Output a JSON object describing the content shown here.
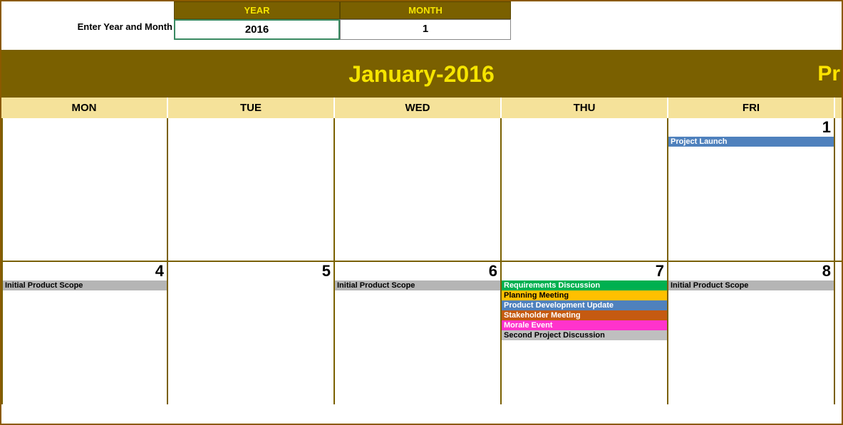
{
  "inputs": {
    "label": "Enter Year and Month",
    "year_header": "YEAR",
    "month_header": "MONTH",
    "year_value": "2016",
    "month_value": "1"
  },
  "title": "January-2016",
  "title_right": "Pr",
  "days": {
    "mon": "MON",
    "tue": "TUE",
    "wed": "WED",
    "thu": "THU",
    "fri": "FRI"
  },
  "week1": {
    "mon": {
      "num": "",
      "events": []
    },
    "tue": {
      "num": "",
      "events": []
    },
    "wed": {
      "num": "",
      "events": []
    },
    "thu": {
      "num": "",
      "events": []
    },
    "fri": {
      "num": "1",
      "events": [
        {
          "label": "Project Launch",
          "cls": "ev-blue"
        }
      ]
    }
  },
  "week2": {
    "mon": {
      "num": "4",
      "events": [
        {
          "label": "Initial Product Scope",
          "cls": "ev-gray"
        }
      ]
    },
    "tue": {
      "num": "5",
      "events": []
    },
    "wed": {
      "num": "6",
      "events": [
        {
          "label": "Initial Product Scope",
          "cls": "ev-gray"
        }
      ]
    },
    "thu": {
      "num": "7",
      "events": [
        {
          "label": "Requirements Discussion",
          "cls": "ev-green"
        },
        {
          "label": "Planning Meeting",
          "cls": "ev-yellow"
        },
        {
          "label": "Product Development Update",
          "cls": "ev-blue"
        },
        {
          "label": "Stakeholder Meeting",
          "cls": "ev-brown"
        },
        {
          "label": "Morale Event",
          "cls": "ev-pink"
        },
        {
          "label": "Second Project Discussion",
          "cls": "ev-ltgray"
        }
      ]
    },
    "fri": {
      "num": "8",
      "events": [
        {
          "label": "Initial Product Scope",
          "cls": "ev-gray"
        }
      ]
    }
  }
}
